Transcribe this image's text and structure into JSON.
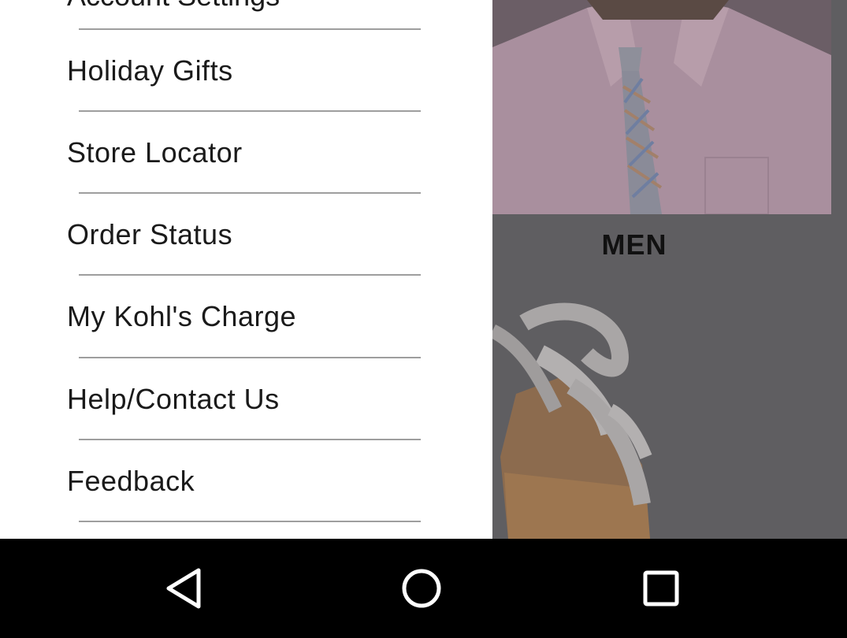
{
  "drawer": {
    "partial_item": "Account Settings",
    "items": [
      {
        "label": "Holiday Gifts"
      },
      {
        "label": "Store Locator"
      },
      {
        "label": "Order Status"
      },
      {
        "label": "My Kohl's Charge"
      },
      {
        "label": "Help/Contact Us"
      },
      {
        "label": "Feedback"
      }
    ]
  },
  "background": {
    "category_label": "MEN"
  },
  "navbar": {
    "back_icon": "back-triangle-icon",
    "home_icon": "home-circle-icon",
    "recents_icon": "recents-square-icon"
  },
  "colors": {
    "drawer_bg": "#ffffff",
    "scrim": "#5f5e61",
    "navbar_bg": "#000000",
    "divider": "#9e9e9e"
  }
}
